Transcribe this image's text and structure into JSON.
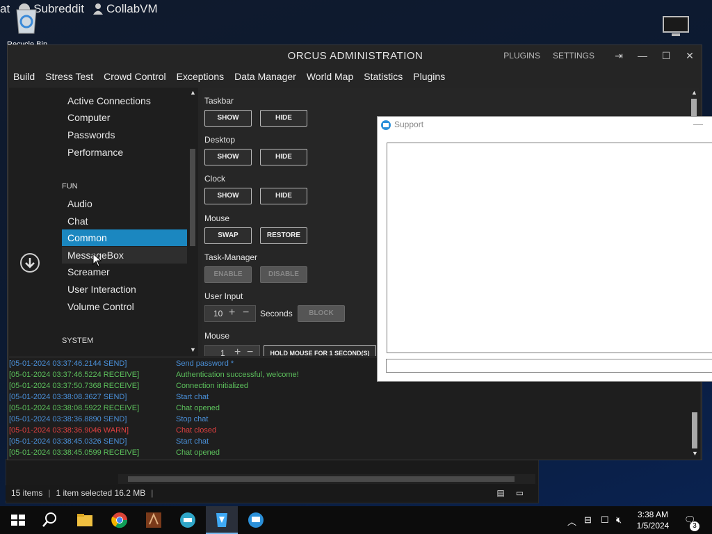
{
  "desktop": {
    "bookmarks": [
      "at",
      "Subreddit",
      "CollabVM"
    ],
    "recycle_label": "Recycle Bin"
  },
  "app": {
    "title": "ORCUS ADMINISTRATION",
    "title_links": [
      "PLUGINS",
      "SETTINGS"
    ],
    "menu": [
      "Build",
      "Stress Test",
      "Crowd Control",
      "Exceptions",
      "Data Manager",
      "World Map",
      "Statistics",
      "Plugins"
    ],
    "nav": {
      "items_top": [
        "Active Connections",
        "Computer",
        "Passwords",
        "Performance"
      ],
      "section_fun": "FUN",
      "items_fun": [
        "Audio",
        "Chat",
        "Common",
        "MessageBox",
        "Screamer",
        "User Interaction",
        "Volume Control"
      ],
      "selected": "Common",
      "section_system": "SYSTEM"
    },
    "common": {
      "groups": [
        {
          "label": "Taskbar",
          "buttons": [
            "SHOW",
            "HIDE"
          ],
          "disabled": false
        },
        {
          "label": "Desktop",
          "buttons": [
            "SHOW",
            "HIDE"
          ],
          "disabled": false
        },
        {
          "label": "Clock",
          "buttons": [
            "SHOW",
            "HIDE"
          ],
          "disabled": false
        },
        {
          "label": "Mouse",
          "buttons": [
            "SWAP",
            "RESTORE"
          ],
          "disabled": false
        },
        {
          "label": "Task-Manager",
          "buttons": [
            "ENABLE",
            "DISABLE"
          ],
          "disabled": true
        }
      ],
      "user_input": {
        "label": "User Input",
        "value": "10",
        "unit": "Seconds",
        "button": "BLOCK"
      },
      "mouse2": {
        "label": "Mouse",
        "value": "1",
        "button": "HOLD MOUSE FOR 1 SECOND(S)"
      }
    },
    "log": [
      {
        "ts": "[05-01-2024 03:37:46.2144 SEND]",
        "msg": "Send password *",
        "kind": "send"
      },
      {
        "ts": "[05-01-2024 03:37:46.5224 RECEIVE]",
        "msg": "Authentication successful, welcome!",
        "kind": "receive"
      },
      {
        "ts": "[05-01-2024 03:37:50.7368 RECEIVE]",
        "msg": "Connection initialized",
        "kind": "receive"
      },
      {
        "ts": "[05-01-2024 03:38:08.3627 SEND]",
        "msg": "Start chat",
        "kind": "send"
      },
      {
        "ts": "[05-01-2024 03:38:08.5922 RECEIVE]",
        "msg": "Chat opened",
        "kind": "receive"
      },
      {
        "ts": "[05-01-2024 03:38:36.8890 SEND]",
        "msg": "Stop chat",
        "kind": "send"
      },
      {
        "ts": "[05-01-2024 03:38:36.9046 WARN]",
        "msg": "Chat closed",
        "kind": "warn"
      },
      {
        "ts": "[05-01-2024 03:38:45.0326 SEND]",
        "msg": "Start chat",
        "kind": "send"
      },
      {
        "ts": "[05-01-2024 03:38:45.0599 RECEIVE]",
        "msg": "Chat opened",
        "kind": "receive"
      }
    ]
  },
  "colors": {
    "send": "#4a90d9",
    "receive": "#5cc05c",
    "warn": "#e04040",
    "accent": "#1b87c0"
  },
  "support": {
    "title": "Support"
  },
  "explorer": {
    "items": "15 items",
    "selected": "1 item selected  16.2 MB"
  },
  "taskbar": {
    "time": "3:38 AM",
    "date": "1/5/2024",
    "notifications": "3",
    "icons": [
      "start-icon",
      "search-icon",
      "file-explorer-icon",
      "chrome-icon",
      "game-icon",
      "app-icon",
      "orcus-icon",
      "chat-icon"
    ]
  }
}
